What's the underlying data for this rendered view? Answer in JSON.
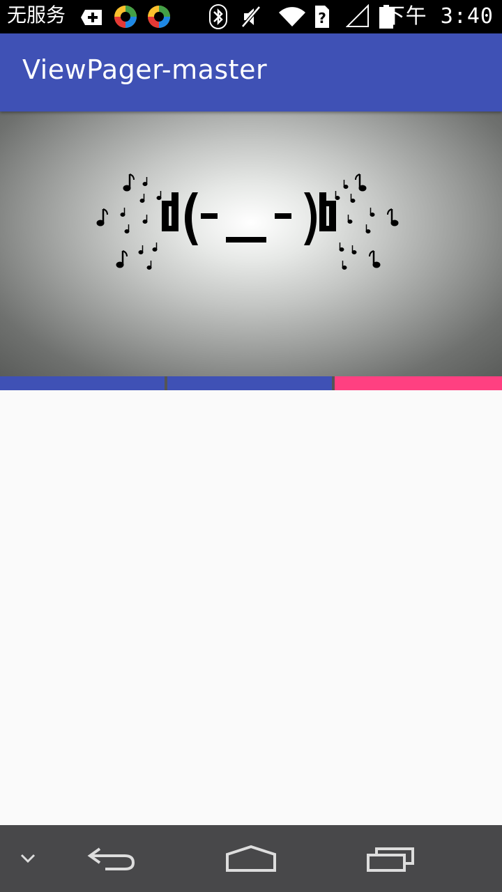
{
  "status_bar": {
    "carrier": "无服务",
    "time": "下午 3:40",
    "icons": [
      "plus-notification-icon",
      "colorful-app-icon",
      "colorful-app-icon",
      "bluetooth-icon",
      "mute-icon",
      "wifi-icon",
      "unknown-sim-icon",
      "signal-icon",
      "battery-icon"
    ]
  },
  "toolbar": {
    "title": "ViewPager-master"
  },
  "pager": {
    "image_text": {
      "face": "d(-_-)b"
    }
  },
  "tabs": {
    "colors": {
      "default": "#3f51b5",
      "selected": "#ff4081",
      "divider": "#555555"
    },
    "selected_index": 2,
    "count": 3
  },
  "nav_bar": {
    "icons": [
      "collapse-chevron-icon",
      "back-icon",
      "home-icon",
      "recents-icon"
    ]
  }
}
